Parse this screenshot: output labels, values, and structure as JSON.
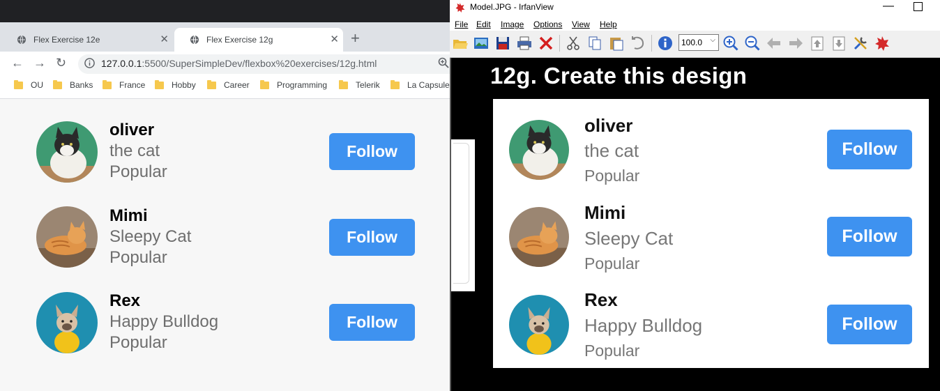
{
  "chrome": {
    "tabs": [
      {
        "title": "Flex Exercise 12e",
        "active": false
      },
      {
        "title": "Flex Exercise 12g",
        "active": true
      }
    ],
    "url": {
      "host": "127.0.0.1",
      "rest": ":5500/SuperSimpleDev/flexbox%20exercises/12g.html"
    },
    "bookmarks": [
      "OU",
      "Banks",
      "France",
      "Hobby",
      "Career",
      "Programming",
      "Telerik",
      "La Capsule"
    ],
    "profiles": [
      {
        "name": "oliver",
        "subtitle": "the cat",
        "status": "Popular",
        "button": "Follow",
        "avatar": "cat-photo"
      },
      {
        "name": "Mimi",
        "subtitle": "Sleepy Cat",
        "status": "Popular",
        "button": "Follow",
        "avatar": "orange-cat-photo"
      },
      {
        "name": "Rex",
        "subtitle": "Happy Bulldog",
        "status": "Popular",
        "button": "Follow",
        "avatar": "bulldog-photo"
      }
    ]
  },
  "irfanview": {
    "title": "Model.JPG - IrfanView",
    "menu": [
      "File",
      "Edit",
      "Image",
      "Options",
      "View",
      "Help"
    ],
    "zoom": "100.0",
    "heading": "12g. Create this design",
    "profiles": [
      {
        "name": "oliver",
        "subtitle": "the cat",
        "status": "Popular",
        "button": "Follow"
      },
      {
        "name": "Mimi",
        "subtitle": "Sleepy Cat",
        "status": "Popular",
        "button": "Follow"
      },
      {
        "name": "Rex",
        "subtitle": "Happy Bulldog",
        "status": "Popular",
        "button": "Follow"
      }
    ]
  },
  "colors": {
    "follow_button": "#3e92f0",
    "chrome_bg": "#f7f7f7",
    "irfan_bg": "#000000"
  }
}
